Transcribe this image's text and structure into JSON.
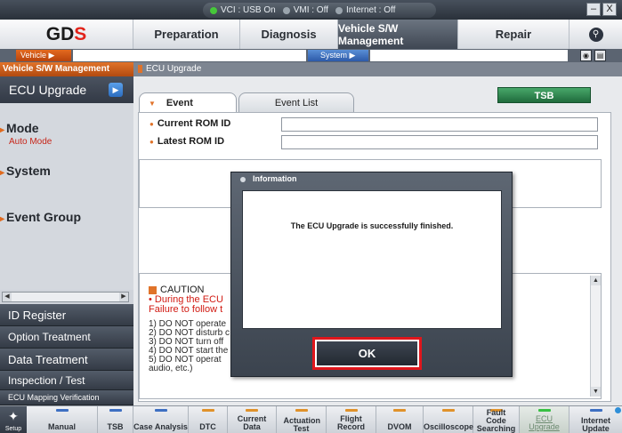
{
  "statusbar": {
    "vci": "VCI : USB On",
    "vmi": "VMI : Off",
    "internet": "Internet : Off"
  },
  "window_controls": {
    "minimize": "–",
    "close": "X"
  },
  "logo": {
    "text_main": "GD",
    "text_accent": "S"
  },
  "mainnav": {
    "tabs": [
      "Preparation",
      "Diagnosis",
      "Vehicle S/W Management",
      "Repair"
    ],
    "active_index": 2
  },
  "selector": {
    "vehicle_label": "Vehicle",
    "vehicle_value": "",
    "system_label": "System",
    "system_value": ""
  },
  "sidebar": {
    "header": "Vehicle S/W Management",
    "active_item": "ECU Upgrade",
    "mode_title": "Mode",
    "mode_value": "Auto Mode",
    "system_title": "System",
    "event_group_title": "Event Group",
    "buttons": [
      "ID Register",
      "Option Treatment",
      "Data Treatment",
      "Inspection / Test",
      "ECU Mapping Verification"
    ]
  },
  "content": {
    "breadcrumb": "ECU Upgrade",
    "tabs": [
      "Event",
      "Event List"
    ],
    "active_tab": 0,
    "tsb_button": "TSB",
    "current_rom_label": "Current ROM ID",
    "current_rom_value": "",
    "latest_rom_label": "Latest ROM ID",
    "latest_rom_value": ""
  },
  "caution": {
    "title": "CAUTION",
    "red_lines": [
      "• During the ECU",
      "Failure to follow t"
    ],
    "items": [
      "1) DO NOT operate",
      "2) DO NOT disturb c",
      "3) DO NOT turn off",
      "4) DO NOT start the",
      "5) DO NOT operat",
      "audio, etc.)"
    ]
  },
  "dialog": {
    "title": "Information",
    "message": "The ECU Upgrade is successfully finished.",
    "ok_label": "OK"
  },
  "bottombar": {
    "setup_label": "Setup",
    "buttons": [
      {
        "label": "Manual",
        "color": "#3d6fc2"
      },
      {
        "label": "TSB",
        "color": "#3d6fc2"
      },
      {
        "label": "Case Analysis",
        "color": "#3d6fc2"
      },
      {
        "label": "DTC",
        "color": "#e0922a"
      },
      {
        "label": "Current Data",
        "color": "#e0922a"
      },
      {
        "label": "Actuation Test",
        "color": "#e0922a"
      },
      {
        "label": "Flight Record",
        "color": "#e0922a"
      },
      {
        "label": "DVOM",
        "color": "#e0922a"
      },
      {
        "label": "Oscilloscope",
        "color": "#e0922a"
      },
      {
        "label": "Fault Code Searching",
        "color": "#e0922a"
      },
      {
        "label": "ECU Upgrade",
        "color": "#37c043"
      },
      {
        "label": "Internet Update",
        "color": "#3d6fc2"
      }
    ],
    "active_button": "ECU Upgrade"
  },
  "colors": {
    "accent_orange": "#e0732a",
    "nav_active": "#3f4753",
    "ok_highlight": "#e0161c",
    "tsb_green": "#1f6b3c"
  }
}
